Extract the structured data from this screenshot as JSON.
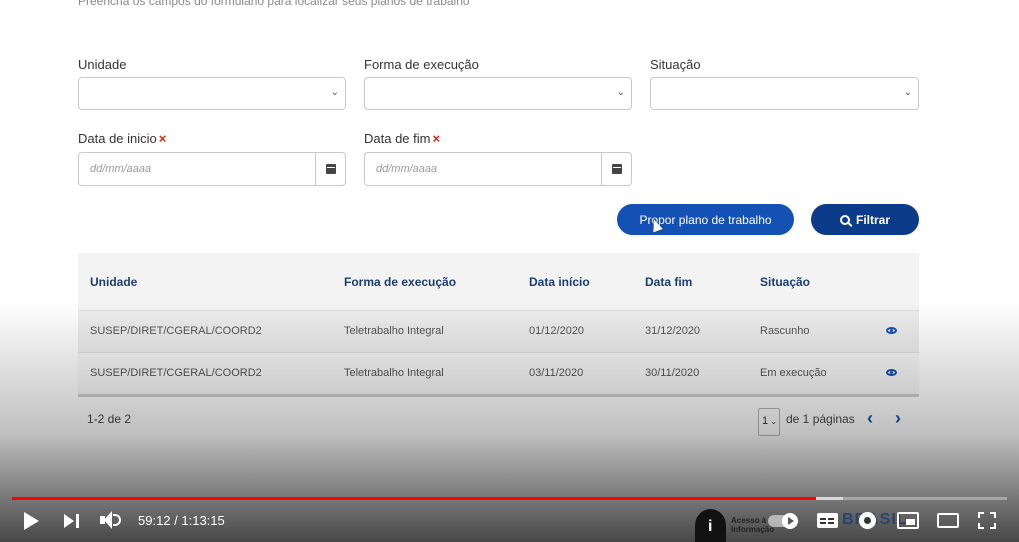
{
  "form": {
    "subtitle": "Preencha os campos do formulário para localizar seus planos de trabalho",
    "unidade_label": "Unidade",
    "forma_label": "Forma de execução",
    "situacao_label": "Situação",
    "data_inicio_label": "Data de inicio",
    "data_fim_label": "Data de fim",
    "required_mark": "×",
    "date_placeholder": "dd/mm/aaaa"
  },
  "actions": {
    "propor_label": "Propor plano de trabalho",
    "filtrar_label": "Filtrar"
  },
  "table": {
    "headers": [
      "Unidade",
      "Forma de execução",
      "Data início",
      "Data fim",
      "Situação"
    ],
    "rows": [
      {
        "unidade": "SUSEP/DIRET/CGERAL/COORD2",
        "forma": "Teletrabalho Integral",
        "inicio": "01/12/2020",
        "fim": "31/12/2020",
        "situacao": "Rascunho"
      },
      {
        "unidade": "SUSEP/DIRET/CGERAL/COORD2",
        "forma": "Teletrabalho Integral",
        "inicio": "03/11/2020",
        "fim": "30/11/2020",
        "situacao": "Em execução"
      }
    ]
  },
  "pagination": {
    "range": "1-2 de 2",
    "current_page": "1",
    "pages_label": "de 1 páginas"
  },
  "player": {
    "time_display": "59:12 / 1:13:15",
    "played_fraction": 0.808,
    "buffered_fraction": 0.835,
    "brand_text_line1": "Acesso à",
    "brand_text_line2": "Informação",
    "brand_mark": "BRASIL",
    "accent_color": "#ff0000"
  },
  "colors": {
    "primary": "#1351b4",
    "primary_dark": "#0c3b8a",
    "header_text": "#1b3d6e",
    "required": "#e52207"
  }
}
